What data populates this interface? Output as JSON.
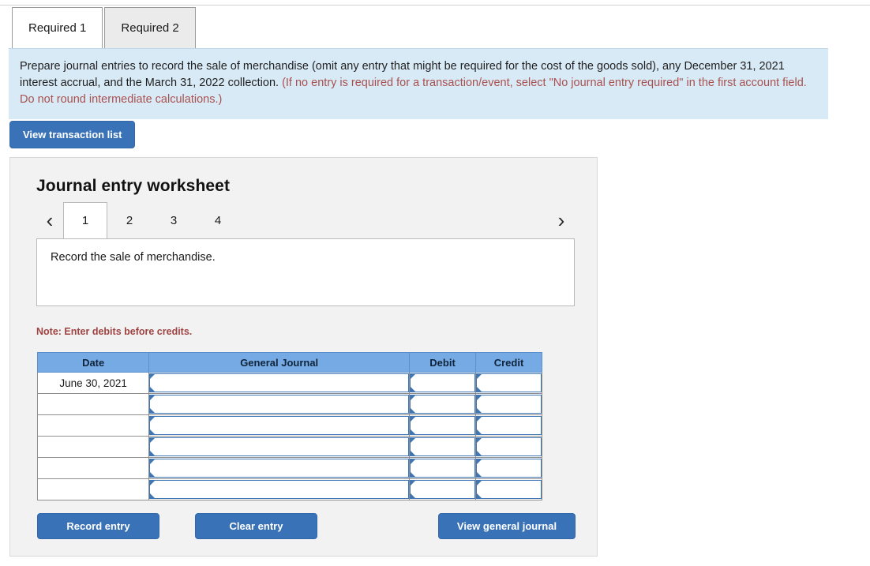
{
  "tabs": [
    {
      "label": "Required 1",
      "active": true
    },
    {
      "label": "Required 2",
      "active": false
    }
  ],
  "instructions": {
    "main": "Prepare journal entries to record the sale of merchandise (omit any entry that might be required for the cost of the goods sold), any December 31, 2021 interest accrual, and the March 31, 2022 collection. ",
    "hint": "(If no entry is required for a transaction/event, select \"No journal entry required\" in the first account field. Do not round intermediate calculations.)"
  },
  "toolbar": {
    "view_transaction_list": "View transaction list"
  },
  "worksheet": {
    "title": "Journal entry worksheet",
    "pager": {
      "prev_icon": "‹",
      "next_icon": "›",
      "pages": [
        "1",
        "2",
        "3",
        "4"
      ],
      "active_page": "1"
    },
    "description": "Record the sale of merchandise.",
    "note": "Note: Enter debits before credits.",
    "table": {
      "columns": [
        "Date",
        "General Journal",
        "Debit",
        "Credit"
      ],
      "rows": [
        {
          "date": "June 30, 2021",
          "general_journal": "",
          "debit": "",
          "credit": ""
        },
        {
          "date": "",
          "general_journal": "",
          "debit": "",
          "credit": ""
        },
        {
          "date": "",
          "general_journal": "",
          "debit": "",
          "credit": ""
        },
        {
          "date": "",
          "general_journal": "",
          "debit": "",
          "credit": ""
        },
        {
          "date": "",
          "general_journal": "",
          "debit": "",
          "credit": ""
        },
        {
          "date": "",
          "general_journal": "",
          "debit": "",
          "credit": ""
        }
      ]
    },
    "buttons": {
      "record": "Record entry",
      "clear": "Clear entry",
      "view_journal": "View general journal"
    }
  },
  "colors": {
    "button_blue": "#3a72b8",
    "table_header_blue": "#75aae4",
    "instruction_panel": "#d9eaf7",
    "note_red": "#9e4543",
    "card_bg": "#f2f2f2",
    "input_border_blue": "#3f76b5"
  }
}
